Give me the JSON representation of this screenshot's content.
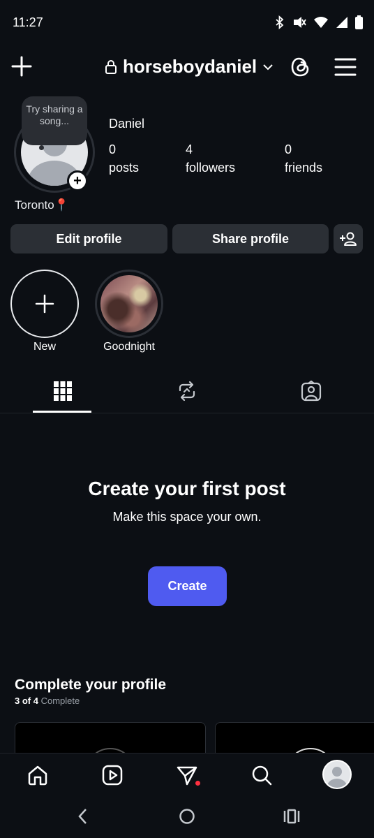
{
  "status_bar": {
    "time": "11:27",
    "icons": [
      "bluetooth-icon",
      "vibrate-off-icon",
      "wifi-icon",
      "signal-icon",
      "battery-icon"
    ]
  },
  "header": {
    "username": "horseboydaniel",
    "icons": [
      "plus-icon",
      "lock-icon",
      "chevron-down-icon",
      "threads-icon",
      "menu-icon"
    ]
  },
  "profile": {
    "note": "Try sharing a song...",
    "location": "Toronto📍",
    "display_name": "Daniel",
    "stats": {
      "posts_count": "0",
      "posts_label": "posts",
      "followers_count": "4",
      "followers_label": "followers",
      "friends_count": "0",
      "friends_label": "friends"
    },
    "add_story_symbol": "+"
  },
  "actions": {
    "edit": "Edit profile",
    "share": "Share profile"
  },
  "highlights": [
    {
      "label": "New"
    },
    {
      "label": "Goodnight"
    }
  ],
  "empty_state": {
    "title": "Create your first post",
    "subtitle": "Make this space your own.",
    "button": "Create"
  },
  "complete_profile": {
    "title": "Complete your profile",
    "progress_count": "3 of 4",
    "progress_word": "Complete"
  },
  "colors": {
    "background": "#0c0f14",
    "button": "#2b2f35",
    "accent": "#4f5bf0",
    "notification": "#ff3040"
  }
}
